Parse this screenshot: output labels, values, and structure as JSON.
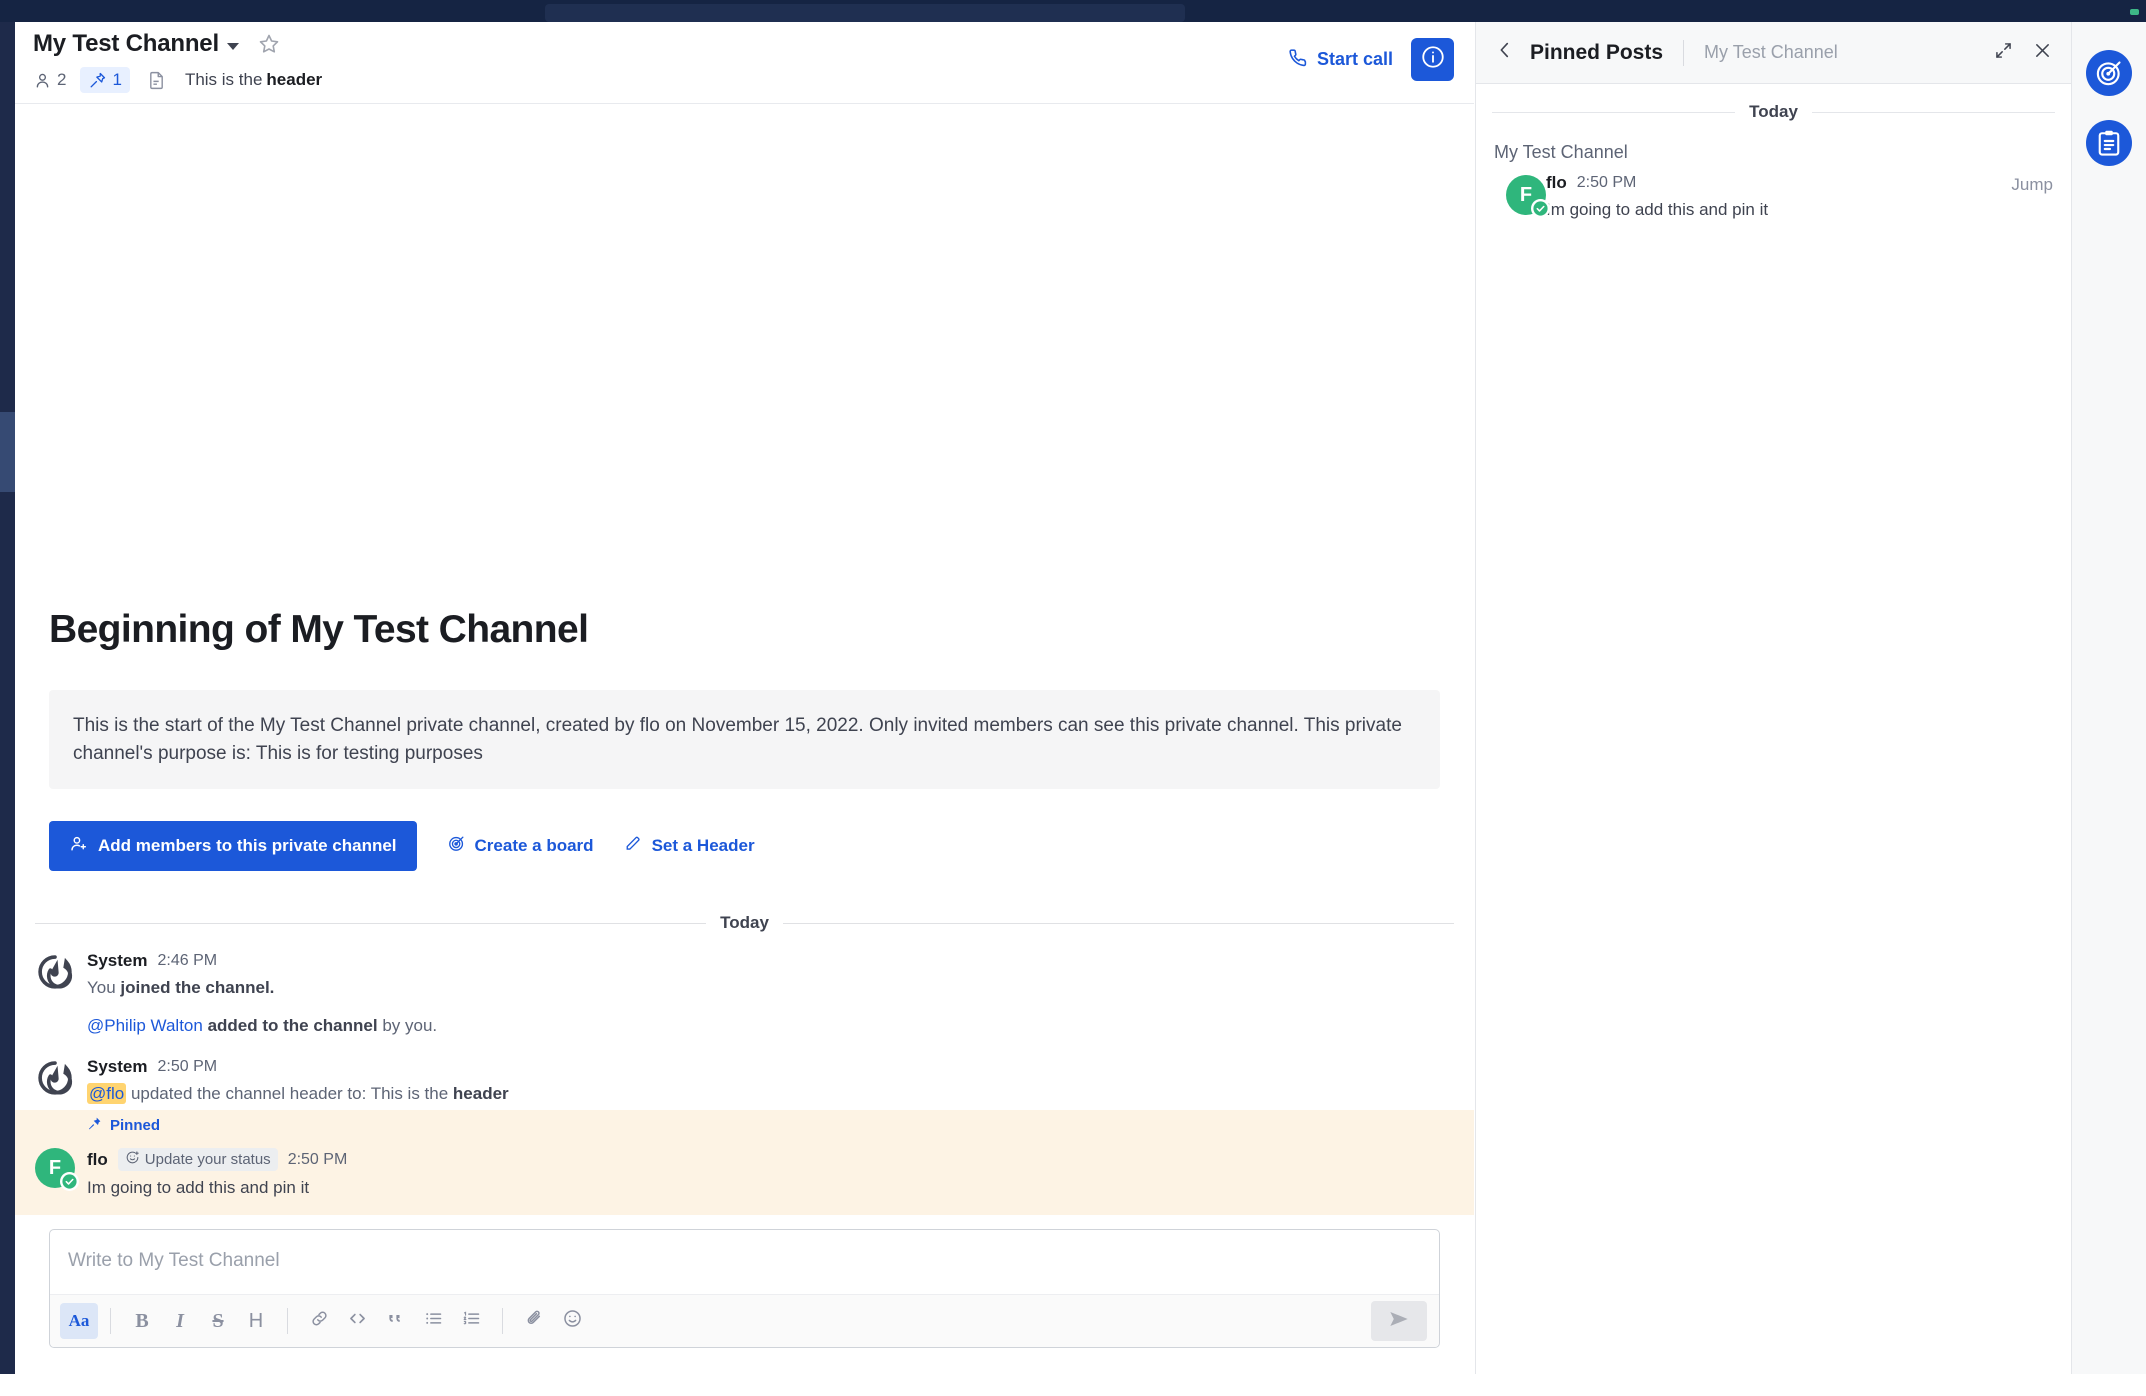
{
  "global": {
    "search_placeholder": "",
    "status_dot_color": "#3db887"
  },
  "channel_header": {
    "title": "My Test Channel",
    "chevron_icon": "chevron-down-icon",
    "favorite_icon": "star-outline-icon",
    "members_count": "2",
    "pinned_count": "1",
    "files_icon": "file-text-icon",
    "header_text_prefix": "This is the ",
    "header_text_bold": "header",
    "start_call_label": "Start call",
    "call_icon": "phone-icon",
    "info_icon": "info-circle-icon",
    "accent_color": "#1c58d9"
  },
  "intro": {
    "title": "Beginning of My Test Channel",
    "purpose": "This is the start of the My Test Channel private channel, created by flo on November 15, 2022. Only invited members can see this private channel. This private channel's purpose is: This is for testing purposes",
    "add_members_label": "Add members to this private channel",
    "add_members_icon": "user-plus-icon",
    "create_board_label": "Create a board",
    "create_board_icon": "target-icon",
    "set_header_label": "Set a Header",
    "set_header_icon": "pencil-icon"
  },
  "post_list": {
    "date_separator": "Today",
    "posts": [
      {
        "author": "System",
        "timestamp": "2:46 PM",
        "avatar": "mattermost-logo-icon",
        "lines": [
          {
            "pre": "You ",
            "bold": "joined the channel.",
            "post": ""
          }
        ],
        "line2": {
          "mention": "@Philip Walton",
          "bold": " added to the channel",
          "post": " by you."
        }
      },
      {
        "author": "System",
        "timestamp": "2:50 PM",
        "avatar": "mattermost-logo-icon",
        "mention_highlight": "@flo",
        "text_mid": " updated the channel header to: This is the ",
        "text_bold": "header"
      },
      {
        "pinned_label": "Pinned",
        "pinned_icon": "pin-icon",
        "author": "flo",
        "avatar_initial": "F",
        "avatar_color": "#2fb67c",
        "status": "online",
        "status_chip_label": "Update your status",
        "status_chip_icon": "emoji-plus-icon",
        "timestamp": "2:50 PM",
        "text": "Im going to add this and pin it",
        "highlight_color": "#fdf3e4"
      }
    ]
  },
  "composer": {
    "placeholder": "Write to My Test Channel",
    "toolbar": [
      {
        "name": "format-toggle-button",
        "glyph": "Aa",
        "active": true
      },
      {
        "name": "bold-button",
        "glyph": "B",
        "active": false
      },
      {
        "name": "italic-button",
        "glyph": "I",
        "active": false
      },
      {
        "name": "strikethrough-button",
        "glyph": "S",
        "active": false
      },
      {
        "name": "heading-button",
        "glyph": "H",
        "active": false
      },
      {
        "name": "link-button",
        "glyph": "link",
        "active": false
      },
      {
        "name": "code-button",
        "glyph": "<>",
        "active": false
      },
      {
        "name": "quote-button",
        "glyph": "“",
        "active": false
      },
      {
        "name": "bulleted-list-button",
        "glyph": "ul",
        "active": false
      },
      {
        "name": "numbered-list-button",
        "glyph": "ol",
        "active": false
      },
      {
        "name": "attachment-button",
        "glyph": "paperclip",
        "active": false
      },
      {
        "name": "emoji-button",
        "glyph": "smiley",
        "active": false
      }
    ],
    "send_icon": "send-icon"
  },
  "rhs": {
    "back_icon": "chevron-left-icon",
    "title": "Pinned Posts",
    "subtitle": "My Test Channel",
    "expand_icon": "expand-arrows-icon",
    "close_icon": "close-x-icon",
    "date_separator": "Today",
    "channel_name": "My Test Channel",
    "posts": [
      {
        "author": "flo",
        "avatar_initial": "F",
        "avatar_color": "#2fb67c",
        "timestamp": "2:50 PM",
        "text": "Im going to add this and pin it",
        "jump_label": "Jump"
      }
    ]
  },
  "app_bar": {
    "items": [
      {
        "name": "boards-icon",
        "label": "Boards"
      },
      {
        "name": "playbooks-icon",
        "label": "Playbooks"
      }
    ],
    "color": "#1c58d9"
  }
}
